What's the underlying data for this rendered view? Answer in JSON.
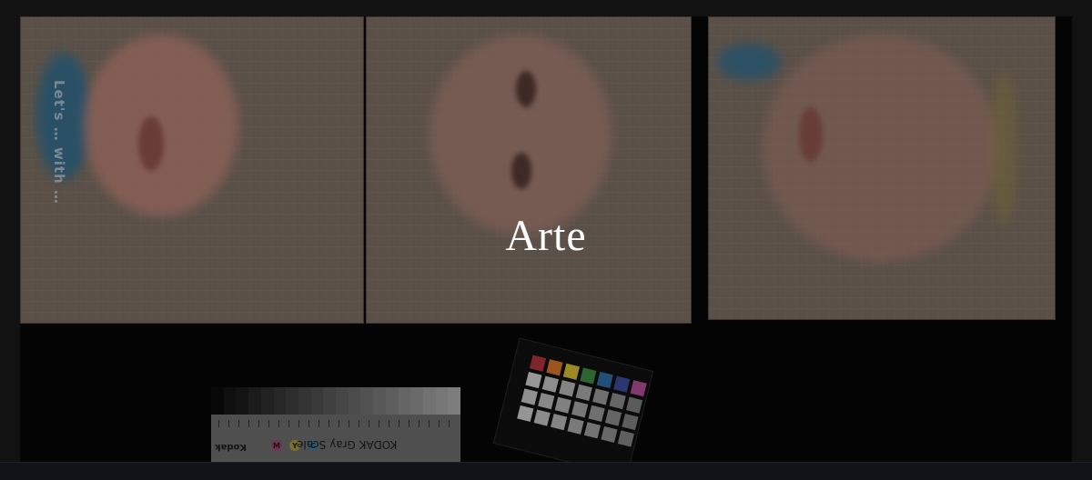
{
  "page": {
    "title": "Arte",
    "background_color": "#121212"
  },
  "hero": {
    "description_icon": "photo-of-three-painted-canvases",
    "canvas_text": "Let's … with …",
    "gray_scale_card": {
      "title": "KODAK Gray Scale",
      "brand": "Kodak",
      "markers": [
        "M",
        "Y",
        "C"
      ]
    },
    "color_checker": {
      "patch_colors": [
        "#b2343a",
        "#d8772c",
        "#d8c035",
        "#3f8b46",
        "#2f6ea6",
        "#3c4a9b",
        "#b04f96",
        "#d0d0d0",
        "#c4c4c4",
        "#b8b8b8",
        "#a9a9a9",
        "#9a9a9a",
        "#8c8c8c",
        "#7e7e7e",
        "#c6c6c6",
        "#bdbdbd",
        "#b2b2b2",
        "#a6a6a6",
        "#9a9a9a",
        "#8d8d8d",
        "#808080",
        "#cfcfcf",
        "#c2c2c2",
        "#b7b7b7",
        "#aaaaaa",
        "#9e9e9e",
        "#919191",
        "#848484"
      ]
    }
  }
}
